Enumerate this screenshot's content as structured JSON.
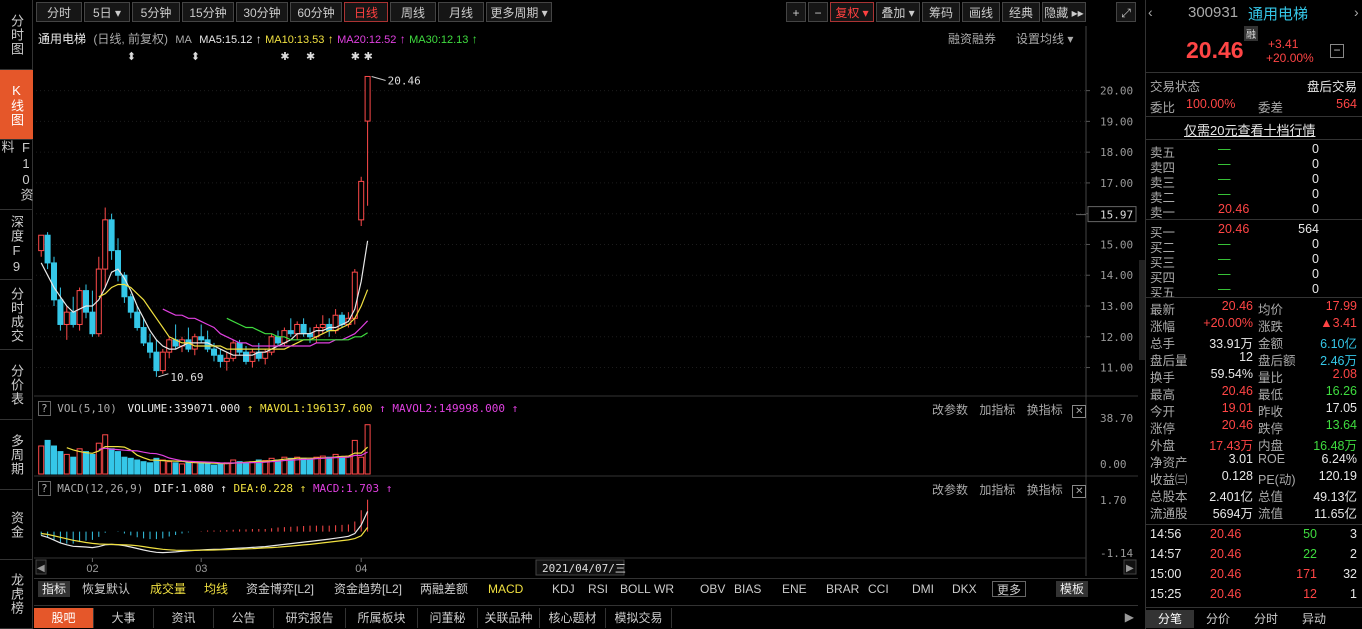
{
  "leftnav": [
    "分时图",
    "K线图",
    "F10资料",
    "深度F9",
    "分时成交",
    "分价表",
    "多周期",
    "资金",
    "龙虎榜"
  ],
  "topbar": {
    "periods": [
      "分时",
      "5日",
      "5分钟",
      "15分钟",
      "30分钟",
      "60分钟",
      "日线",
      "周线",
      "月线",
      "更多周期"
    ],
    "active_period": "日线",
    "right_tools": [
      "+",
      "−",
      "复权",
      "叠加",
      "筹码",
      "画线",
      "经典",
      "隐藏"
    ]
  },
  "legend": {
    "name": "通用电梯",
    "mode": "(日线, 前复权)",
    "ma_label": "MA",
    "ma5": "MA5:15.12",
    "ma10": "MA10:13.53",
    "ma20": "MA20:12.52",
    "ma30": "MA30:12.13",
    "rzrq": "融资融券",
    "setma": "设置均线"
  },
  "vol_legend": {
    "title": "VOL(5,10)",
    "volume": "VOLUME:339071.000",
    "mavol1": "MAVOL1:196137.600",
    "mavol2": "MAVOL2:149998.000"
  },
  "macd_legend": {
    "title": "MACD(12,26,9)",
    "dif": "DIF:1.080",
    "dea": "DEA:0.228",
    "macd": "MACD:1.703"
  },
  "panel_tools": [
    "改参数",
    "加指标",
    "换指标"
  ],
  "annotations": {
    "high": "20.46",
    "low": "10.69",
    "crosshair_price": "15.97",
    "date": "2021/04/07/三"
  },
  "price_axis": [
    "20.00",
    "19.00",
    "18.00",
    "17.00",
    "16.00",
    "15.00",
    "14.00",
    "13.00",
    "12.00",
    "11.00"
  ],
  "vol_axis": [
    "38.70",
    "0.00"
  ],
  "macd_axis": [
    "1.70",
    "-1.14"
  ],
  "x_axis": [
    "02",
    "03",
    "04"
  ],
  "indicator_tabs": [
    "指标",
    "恢复默认",
    "成交量",
    "均线",
    "资金博弈[L2]",
    "资金趋势[L2]",
    "两融差额",
    "MACD",
    "KDJ",
    "RSI",
    "BOLL",
    "WR",
    "OBV",
    "BIAS",
    "ENE",
    "BRAR",
    "CCI",
    "DMI",
    "DKX",
    "更多",
    "模板"
  ],
  "bottom_tabs": [
    "股吧",
    "大事",
    "资讯",
    "公告",
    "研究报告",
    "所属板块",
    "问董秘",
    "关联品种",
    "核心题材",
    "模拟交易"
  ],
  "quote": {
    "code": "300931",
    "name": "通用电梯",
    "badge": "融",
    "price": "20.46",
    "change": "+3.41",
    "pct": "+20.00%",
    "status_label": "交易状态",
    "status": "盘后交易",
    "wb_label": "委比",
    "wb": "100.00%",
    "wc_label": "委差",
    "wc": "564",
    "promo": "仅需20元查看十档行情"
  },
  "asks": [
    {
      "label": "卖五",
      "price": "—",
      "vol": "0"
    },
    {
      "label": "卖四",
      "price": "—",
      "vol": "0"
    },
    {
      "label": "卖三",
      "price": "—",
      "vol": "0"
    },
    {
      "label": "卖二",
      "price": "—",
      "vol": "0"
    },
    {
      "label": "卖一",
      "price": "20.46",
      "vol": "0"
    }
  ],
  "bids": [
    {
      "label": "买一",
      "price": "20.46",
      "vol": "564"
    },
    {
      "label": "买二",
      "price": "—",
      "vol": "0"
    },
    {
      "label": "买三",
      "price": "—",
      "vol": "0"
    },
    {
      "label": "买四",
      "price": "—",
      "vol": "0"
    },
    {
      "label": "买五",
      "price": "—",
      "vol": "0"
    }
  ],
  "stats": [
    {
      "l1": "最新",
      "v1": "20.46",
      "c1": "red",
      "l2": "均价",
      "v2": "17.99",
      "c2": "red"
    },
    {
      "l1": "涨幅",
      "v1": "+20.00%",
      "c1": "red",
      "l2": "涨跌",
      "v2": "▲3.41",
      "c2": "red"
    },
    {
      "l1": "总手",
      "v1": "33.91万",
      "c1": "wht",
      "l2": "金额",
      "v2": "6.10亿",
      "c2": "cyan"
    },
    {
      "l1": "盘后量",
      "v1": "12",
      "c1": "wht",
      "l2": "盘后额",
      "v2": "2.46万",
      "c2": "cyan"
    },
    {
      "l1": "换手",
      "v1": "59.54%",
      "c1": "wht",
      "l2": "量比",
      "v2": "2.08",
      "c2": "red"
    },
    {
      "l1": "最高",
      "v1": "20.46",
      "c1": "red",
      "l2": "最低",
      "v2": "16.26",
      "c2": "green"
    },
    {
      "l1": "今开",
      "v1": "19.01",
      "c1": "red",
      "l2": "昨收",
      "v2": "17.05",
      "c2": "wht"
    },
    {
      "l1": "涨停",
      "v1": "20.46",
      "c1": "red",
      "l2": "跌停",
      "v2": "13.64",
      "c2": "green"
    },
    {
      "l1": "外盘",
      "v1": "17.43万",
      "c1": "red",
      "l2": "内盘",
      "v2": "16.48万",
      "c2": "green"
    },
    {
      "l1": "净资产",
      "v1": "3.01",
      "c1": "wht",
      "l2": "ROE",
      "v2": "6.24%",
      "c2": "wht"
    },
    {
      "l1": "收益㈢",
      "v1": "0.128",
      "c1": "wht",
      "l2": "PE(动)",
      "v2": "120.19",
      "c2": "wht"
    },
    {
      "l1": "总股本",
      "v1": "2.401亿",
      "c1": "wht",
      "l2": "总值",
      "v2": "49.13亿",
      "c2": "wht"
    },
    {
      "l1": "流通股",
      "v1": "5694万",
      "c1": "wht",
      "l2": "流值",
      "v2": "11.65亿",
      "c2": "wht"
    }
  ],
  "ticks": [
    {
      "time": "14:56",
      "price": "20.46",
      "vol": "50",
      "n": "3"
    },
    {
      "time": "14:57",
      "price": "20.46",
      "vol": "22",
      "n": "2"
    },
    {
      "time": "15:00",
      "price": "20.46",
      "vol": "171",
      "n": "32"
    },
    {
      "time": "15:25",
      "price": "20.46",
      "vol": "12",
      "n": "1"
    }
  ],
  "right_tabs": [
    "分笔",
    "分价",
    "分时",
    "异动"
  ],
  "chart_data": {
    "type": "candlestick",
    "price_range": [
      10.4,
      20.8
    ],
    "candles": [
      [
        14.8,
        15.3,
        14.6,
        15.3
      ],
      [
        15.3,
        15.4,
        14.2,
        14.4
      ],
      [
        14.4,
        14.6,
        13.0,
        13.2
      ],
      [
        13.2,
        13.6,
        12.2,
        12.4
      ],
      [
        12.4,
        13.0,
        11.9,
        12.8
      ],
      [
        12.8,
        13.3,
        12.3,
        12.4
      ],
      [
        12.4,
        13.6,
        12.2,
        13.5
      ],
      [
        13.5,
        13.7,
        12.6,
        12.8
      ],
      [
        12.8,
        13.5,
        12.0,
        12.1
      ],
      [
        12.1,
        14.6,
        12.0,
        14.2
      ],
      [
        14.2,
        16.2,
        13.6,
        15.8
      ],
      [
        15.8,
        16.0,
        14.5,
        14.8
      ],
      [
        14.8,
        15.2,
        13.8,
        14.0
      ],
      [
        14.0,
        14.1,
        13.1,
        13.3
      ],
      [
        13.3,
        13.4,
        12.6,
        12.8
      ],
      [
        12.8,
        13.0,
        12.2,
        12.3
      ],
      [
        12.3,
        12.6,
        11.7,
        11.8
      ],
      [
        11.8,
        12.1,
        11.3,
        11.5
      ],
      [
        11.5,
        11.9,
        10.7,
        10.9
      ],
      [
        10.9,
        11.6,
        10.8,
        11.5
      ],
      [
        11.5,
        12.0,
        11.3,
        11.9
      ],
      [
        11.9,
        12.4,
        11.6,
        11.7
      ],
      [
        11.7,
        12.0,
        11.5,
        11.9
      ],
      [
        11.9,
        12.3,
        11.5,
        11.6
      ],
      [
        11.6,
        12.1,
        11.4,
        12.0
      ],
      [
        12.0,
        12.4,
        11.8,
        11.9
      ],
      [
        11.9,
        12.2,
        11.5,
        11.6
      ],
      [
        11.6,
        11.8,
        11.2,
        11.4
      ],
      [
        11.4,
        11.6,
        11.0,
        11.2
      ],
      [
        11.2,
        11.5,
        10.9,
        11.3
      ],
      [
        11.3,
        11.9,
        11.2,
        11.8
      ],
      [
        11.8,
        11.9,
        11.4,
        11.5
      ],
      [
        11.5,
        11.7,
        11.1,
        11.2
      ],
      [
        11.2,
        11.6,
        11.0,
        11.5
      ],
      [
        11.5,
        11.8,
        11.2,
        11.3
      ],
      [
        11.3,
        11.6,
        11.1,
        11.5
      ],
      [
        11.5,
        12.1,
        11.4,
        12.0
      ],
      [
        12.0,
        12.2,
        11.7,
        11.8
      ],
      [
        11.8,
        12.3,
        11.7,
        12.2
      ],
      [
        12.2,
        12.6,
        12.0,
        12.1
      ],
      [
        12.1,
        12.5,
        11.9,
        12.4
      ],
      [
        12.4,
        12.6,
        12.0,
        12.1
      ],
      [
        12.1,
        12.3,
        11.8,
        12.0
      ],
      [
        12.0,
        12.4,
        11.8,
        12.3
      ],
      [
        12.3,
        12.7,
        12.1,
        12.4
      ],
      [
        12.4,
        12.6,
        12.0,
        12.2
      ],
      [
        12.2,
        12.9,
        12.1,
        12.7
      ],
      [
        12.7,
        12.8,
        12.3,
        12.4
      ],
      [
        12.4,
        12.8,
        12.3,
        12.6
      ],
      [
        12.6,
        14.2,
        12.4,
        14.1
      ],
      [
        15.8,
        17.2,
        15.6,
        17.05
      ],
      [
        19.01,
        20.46,
        16.26,
        20.46
      ]
    ],
    "ma5": [
      14.4,
      14.0,
      13.6,
      13.3,
      13.0,
      12.8,
      12.9,
      13.0,
      13.0,
      13.2,
      13.6,
      14.1,
      14.2,
      13.9,
      13.5,
      13.0,
      12.6,
      12.2,
      11.9,
      11.7,
      11.6,
      11.6,
      11.7,
      11.8,
      11.8,
      11.8,
      11.8,
      11.7,
      11.6,
      11.5,
      11.4,
      11.4,
      11.4,
      11.4,
      11.5,
      11.5,
      11.6,
      11.7,
      11.8,
      11.9,
      12.1,
      12.1,
      12.1,
      12.2,
      12.2,
      12.3,
      12.3,
      12.4,
      12.5,
      12.9,
      13.8,
      15.12
    ],
    "ma10": [
      null,
      null,
      null,
      null,
      null,
      null,
      null,
      null,
      null,
      13.3,
      13.4,
      13.6,
      13.7,
      13.7,
      13.6,
      13.4,
      13.2,
      12.9,
      12.6,
      12.3,
      12.0,
      11.9,
      11.8,
      11.8,
      11.7,
      11.7,
      11.7,
      11.7,
      11.7,
      11.6,
      11.6,
      11.6,
      11.6,
      11.6,
      11.6,
      11.6,
      11.6,
      11.6,
      11.6,
      11.7,
      11.8,
      11.9,
      11.9,
      12.0,
      12.1,
      12.2,
      12.2,
      12.3,
      12.4,
      12.6,
      13.0,
      13.53
    ],
    "ma20": [
      null,
      null,
      null,
      null,
      null,
      null,
      null,
      null,
      null,
      null,
      null,
      null,
      null,
      null,
      null,
      null,
      null,
      null,
      null,
      12.9,
      12.8,
      12.7,
      12.7,
      12.6,
      12.6,
      12.5,
      12.4,
      12.3,
      12.1,
      12.0,
      11.9,
      11.8,
      11.8,
      11.7,
      11.7,
      11.7,
      11.7,
      11.7,
      11.7,
      11.7,
      11.7,
      11.7,
      11.7,
      11.8,
      11.8,
      11.8,
      11.9,
      11.9,
      12.0,
      12.1,
      12.3,
      12.52
    ],
    "ma30": [
      null,
      null,
      null,
      null,
      null,
      null,
      null,
      null,
      null,
      null,
      null,
      null,
      null,
      null,
      null,
      null,
      null,
      null,
      null,
      null,
      null,
      null,
      null,
      null,
      null,
      null,
      null,
      null,
      null,
      12.6,
      12.5,
      12.4,
      12.3,
      12.3,
      12.2,
      12.1,
      12.1,
      12.0,
      12.0,
      11.9,
      11.9,
      11.9,
      11.9,
      11.9,
      11.9,
      11.9,
      11.9,
      11.9,
      11.9,
      12.0,
      12.0,
      12.13
    ],
    "volume": [
      0.5,
      0.6,
      0.5,
      0.4,
      0.35,
      0.3,
      0.45,
      0.4,
      0.35,
      0.55,
      0.7,
      0.45,
      0.4,
      0.3,
      0.28,
      0.25,
      0.22,
      0.2,
      0.28,
      0.25,
      0.22,
      0.2,
      0.18,
      0.2,
      0.22,
      0.2,
      0.18,
      0.16,
      0.18,
      0.2,
      0.25,
      0.22,
      0.2,
      0.22,
      0.25,
      0.24,
      0.28,
      0.25,
      0.3,
      0.28,
      0.3,
      0.28,
      0.25,
      0.3,
      0.32,
      0.3,
      0.35,
      0.3,
      0.32,
      0.6,
      0.3,
      0.88
    ],
    "macd_range": [
      -1.3,
      1.9
    ],
    "dif": [
      -0.2,
      -0.3,
      -0.45,
      -0.6,
      -0.7,
      -0.78,
      -0.8,
      -0.82,
      -0.85,
      -0.8,
      -0.7,
      -0.68,
      -0.7,
      -0.75,
      -0.82,
      -0.9,
      -0.98,
      -1.05,
      -1.1,
      -1.12,
      -1.1,
      -1.08,
      -1.05,
      -1.02,
      -1.0,
      -0.98,
      -0.96,
      -0.95,
      -0.94,
      -0.92,
      -0.9,
      -0.88,
      -0.86,
      -0.84,
      -0.82,
      -0.8,
      -0.76,
      -0.72,
      -0.68,
      -0.64,
      -0.6,
      -0.56,
      -0.52,
      -0.48,
      -0.44,
      -0.4,
      -0.35,
      -0.3,
      -0.25,
      -0.1,
      0.35,
      1.08
    ],
    "dea": [
      -0.1,
      -0.15,
      -0.22,
      -0.3,
      -0.38,
      -0.46,
      -0.52,
      -0.58,
      -0.63,
      -0.66,
      -0.67,
      -0.68,
      -0.69,
      -0.7,
      -0.72,
      -0.75,
      -0.8,
      -0.85,
      -0.9,
      -0.94,
      -0.97,
      -0.99,
      -1.0,
      -1.0,
      -1.0,
      -0.99,
      -0.99,
      -0.98,
      -0.97,
      -0.96,
      -0.95,
      -0.94,
      -0.92,
      -0.91,
      -0.89,
      -0.87,
      -0.85,
      -0.83,
      -0.8,
      -0.77,
      -0.74,
      -0.71,
      -0.68,
      -0.64,
      -0.6,
      -0.56,
      -0.52,
      -0.48,
      -0.44,
      -0.37,
      -0.22,
      0.228
    ]
  }
}
